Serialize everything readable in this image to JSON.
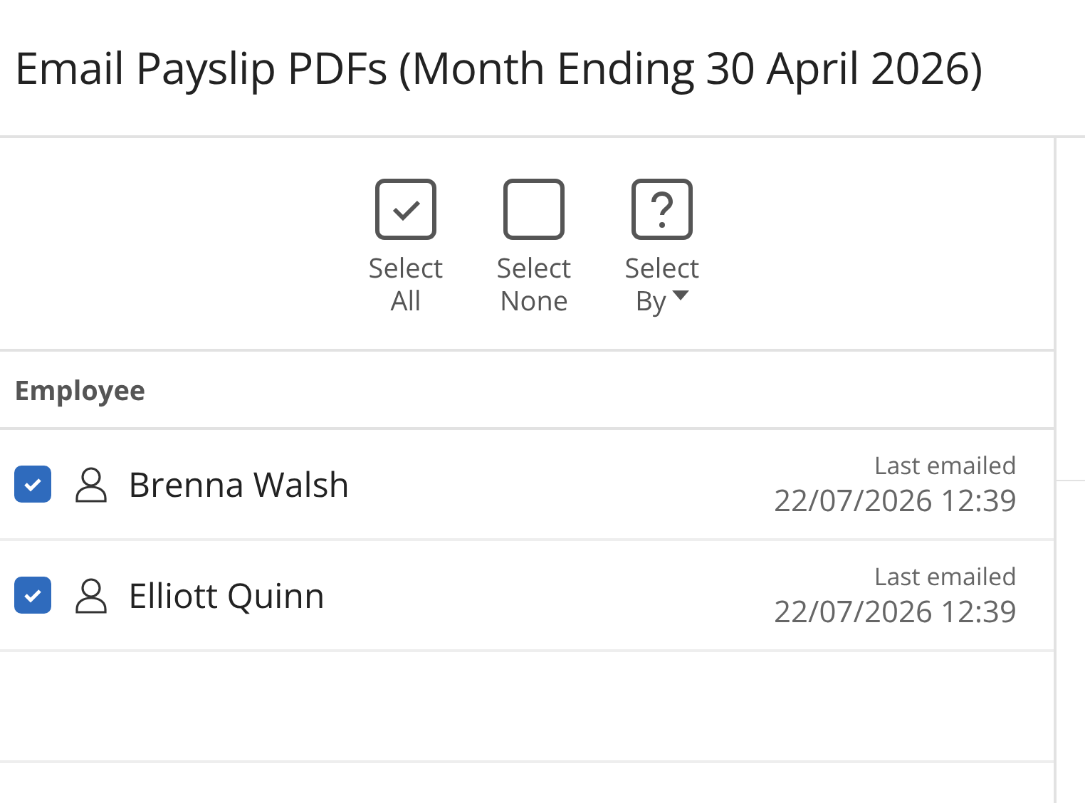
{
  "window": {
    "title": "Email Payslip PDFs (Month Ending 30 April 2026)"
  },
  "toolbar": [
    {
      "kind": "all",
      "line1": "Select",
      "line2": "All"
    },
    {
      "kind": "none",
      "line1": "Select",
      "line2": "None"
    },
    {
      "kind": "by",
      "line1": "Select",
      "line2": "By"
    }
  ],
  "table": {
    "columns": [
      "Employee"
    ],
    "rows": [
      {
        "checked": true,
        "name": "Brenna Walsh",
        "note": "Last emailed",
        "date": "22/07/2026 12:39"
      },
      {
        "checked": true,
        "name": "Elliott Quinn",
        "note": "Last emailed",
        "date": "22/07/2026 12:39"
      }
    ]
  }
}
